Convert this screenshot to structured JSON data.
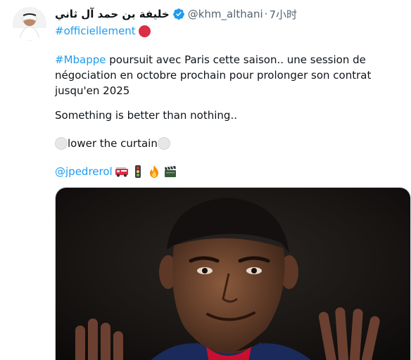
{
  "author": {
    "display_name": "خليفة بن حمد آل ثاني",
    "verified": true,
    "handle": "@khm_althani",
    "separator": "·",
    "time": "7小时"
  },
  "hashtag_line": {
    "hashtag": "#officiellement",
    "emoji": "red-circle"
  },
  "body": {
    "hashtag": "#Mbappe",
    "paragraph1_rest": " poursuit avec Paris cette saison.. une session de négociation en octobre prochain pour prolonger son contrat jusqu'en 2025",
    "paragraph2": "Something is better than nothing..",
    "paragraph3": "lower the curtain",
    "mention": "@jpedrerol",
    "emojis": [
      "fire-engine",
      "vertical-traffic-light",
      "fire",
      "clapper-board"
    ]
  },
  "media": {
    "description_icon": "photo"
  },
  "colors": {
    "link": "#1d9bf0",
    "text": "#0f1419",
    "secondary": "#536471",
    "verified": "#1d9bf0",
    "red_circle": "#dd2e44"
  }
}
